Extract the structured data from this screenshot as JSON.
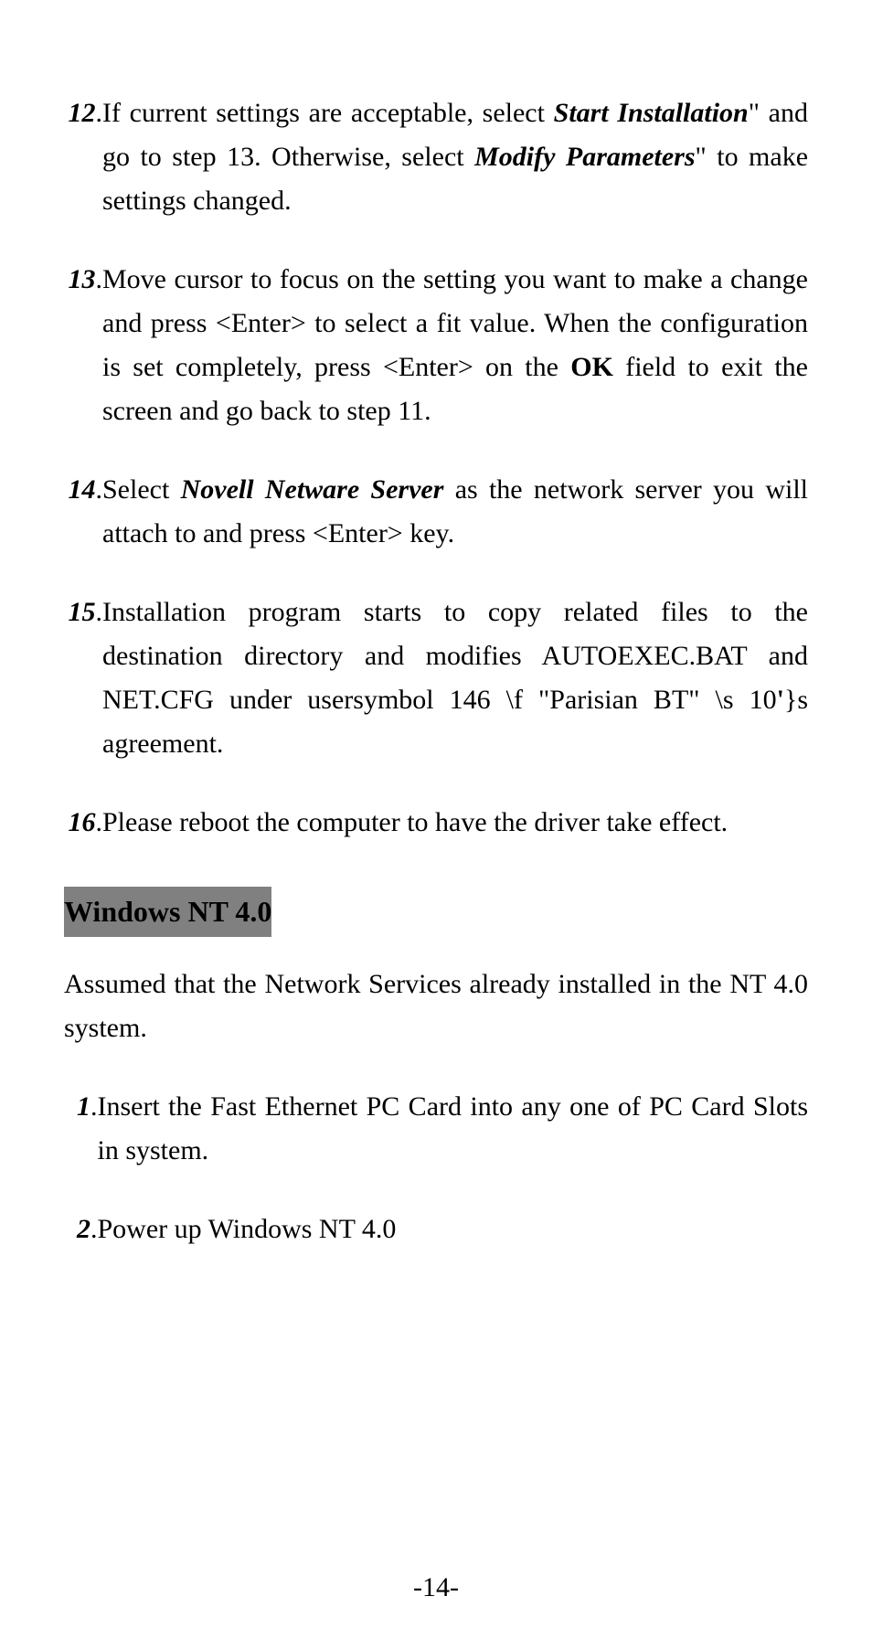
{
  "items": [
    {
      "num": "12",
      "parts": [
        {
          "text": "If current settings are acceptable, select ",
          "style": ""
        },
        {
          "text": "Start Installation",
          "style": "bold-italic"
        },
        {
          "text": "\" and go to step 13. Otherwise, select ",
          "style": ""
        },
        {
          "text": "Modify Parameters",
          "style": "bold-italic"
        },
        {
          "text": "\" to make settings changed.",
          "style": ""
        }
      ]
    },
    {
      "num": "13",
      "parts": [
        {
          "text": "Move cursor to focus on the setting you want to make a change and press <Enter> to select a fit value.  When the configuration is set completely, press <Enter> on the ",
          "style": ""
        },
        {
          "text": "OK",
          "style": "bold"
        },
        {
          "text": " field to exit the screen and go back to step 11.",
          "style": ""
        }
      ]
    },
    {
      "num": "14",
      "parts": [
        {
          "text": "Select ",
          "style": ""
        },
        {
          "text": "Novell Netware Server",
          "style": "bold-italic"
        },
        {
          "text": " as the network server you will attach to and press <Enter> key.",
          "style": ""
        }
      ]
    },
    {
      "num": "15",
      "parts": [
        {
          "text": "Installation program starts to copy related files to the destination directory and modifies AUTOEXEC.BAT and NET.CFG under usersymbol 146 \\f \"Parisian BT\" \\s 10",
          "style": ""
        },
        {
          "text": "'",
          "style": "bold"
        },
        {
          "text": "}s agreement.",
          "style": ""
        }
      ]
    },
    {
      "num": "16",
      "parts": [
        {
          "text": "Please reboot the computer to have the driver take effect.",
          "style": ""
        }
      ]
    }
  ],
  "heading": "Windows NT 4.0",
  "paragraph": "Assumed that the Network Services already installed in the NT 4.0 system.",
  "sub_items": [
    {
      "num": "1",
      "parts": [
        {
          "text": "Insert the Fast Ethernet PC Card into any one of PC Card Slots in system.",
          "style": ""
        }
      ]
    },
    {
      "num": "2",
      "parts": [
        {
          "text": "Power up Windows NT 4.0",
          "style": ""
        }
      ]
    }
  ],
  "page_number": "-14-"
}
